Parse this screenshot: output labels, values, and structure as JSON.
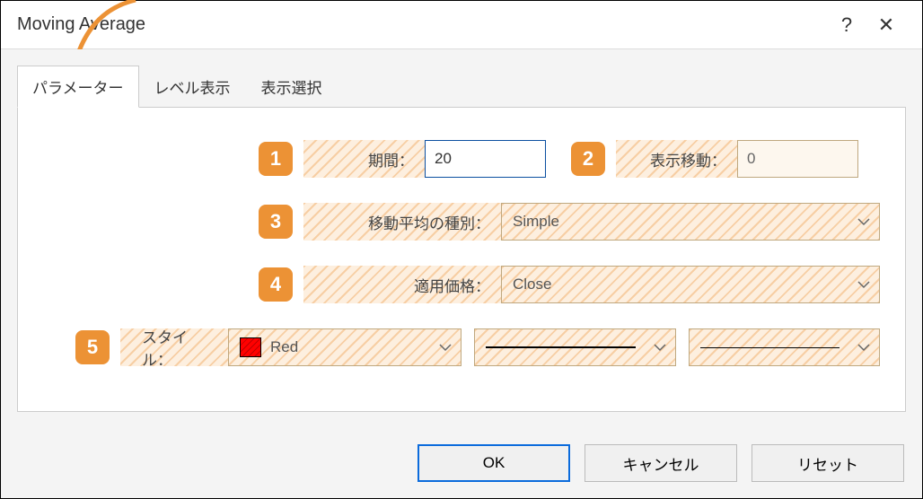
{
  "title": "Moving Average",
  "tabs": [
    "パラメーター",
    "レベル表示",
    "表示選択"
  ],
  "badges": {
    "b1": "1",
    "b2": "2",
    "b3": "3",
    "b4": "4",
    "b5": "5"
  },
  "labels": {
    "period": "期間：",
    "shift": "表示移動：",
    "method": "移動平均の種別：",
    "apply_to": "適用価格：",
    "style": "スタイル："
  },
  "values": {
    "period": "20",
    "shift": "0",
    "method": "Simple",
    "apply_to": "Close",
    "color_name": "Red"
  },
  "buttons": {
    "ok": "OK",
    "cancel": "キャンセル",
    "reset": "リセット"
  },
  "titlebar": {
    "help": "?",
    "close": "✕"
  }
}
